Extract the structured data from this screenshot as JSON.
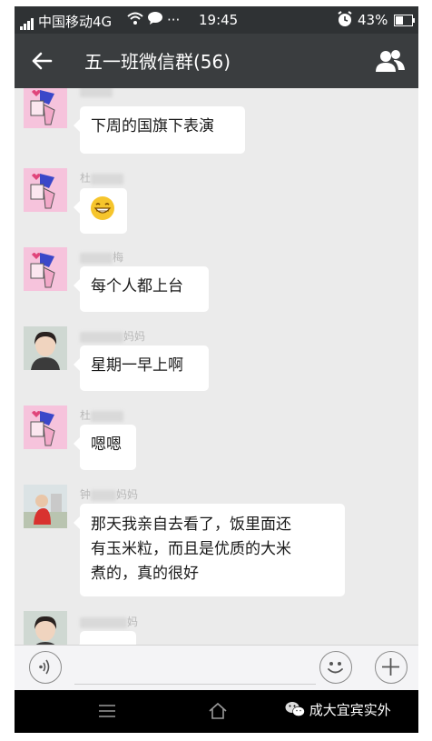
{
  "status_bar": {
    "carrier": "中国移动4G",
    "extras": "···",
    "time": "19:45",
    "battery": "43%"
  },
  "header": {
    "title": "五一班微信群(56)"
  },
  "messages": [
    {
      "sender_suffix": "",
      "text": "下周的国旗下表演"
    },
    {
      "sender_prefix": "杜",
      "sender_suffix": "",
      "text": "😁"
    },
    {
      "sender_prefix": "",
      "sender_suffix": "梅",
      "text": "每个人都上台"
    },
    {
      "sender_prefix": "",
      "sender_suffix": "妈妈",
      "text": "星期一早上啊"
    },
    {
      "sender_prefix": "杜",
      "sender_suffix": "",
      "text": "嗯嗯"
    },
    {
      "sender_prefix": "钟",
      "sender_suffix": "妈妈",
      "text_lines": [
        "那天我亲自去看了，饭里面还",
        "有玉米粒，而且是优质的大米",
        "煮的，真的很好"
      ]
    },
    {
      "sender_prefix": "",
      "sender_suffix": "妈",
      "text": ""
    }
  ],
  "input": {
    "value": ""
  },
  "watermark": "成大宜宾实外",
  "icons": {
    "back": "arrow-left-icon",
    "members": "group-icon",
    "voice": "voice-icon",
    "emoji": "emoji-icon",
    "add": "plus-icon",
    "menu": "menu-icon",
    "home": "home-icon",
    "wechat": "wechat-logo-icon"
  },
  "colors": {
    "title_bar": "#3a3d3f",
    "chat_background": "#ebebeb",
    "bubble": "#ffffff"
  }
}
